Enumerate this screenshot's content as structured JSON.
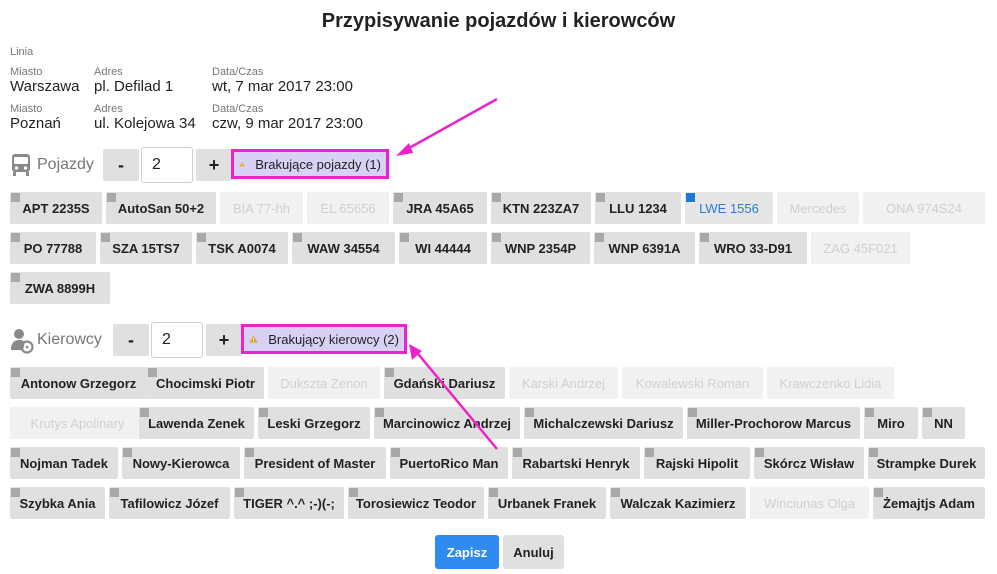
{
  "title": "Przypisywanie pojazdów i kierowców",
  "line_label": "Linia",
  "stops": [
    {
      "city_label": "Miasto",
      "city": "Warszawa",
      "address_label": "Adres",
      "address": "pl. Defilad 1",
      "datetime_label": "Data/Czas",
      "datetime": "wt, 7 mar 2017 23:00"
    },
    {
      "city_label": "Miasto",
      "city": "Poznań",
      "address_label": "Adres",
      "address": "ul. Kolejowa 34",
      "datetime_label": "Data/Czas",
      "datetime": "czw, 9 mar 2017 23:00"
    }
  ],
  "vehicles": {
    "label": "Pojazdy",
    "icon": "bus-icon",
    "minus": "-",
    "plus": "+",
    "count": "2",
    "warning": "Brakujące pojazdy (1)",
    "items": [
      {
        "label": "APT 2235S",
        "state": "normal"
      },
      {
        "label": "AutoSan 50+2",
        "state": "normal"
      },
      {
        "label": "BIA 77-hh",
        "state": "disabled"
      },
      {
        "label": "EL 65656",
        "state": "disabled"
      },
      {
        "label": "JRA 45A65",
        "state": "normal"
      },
      {
        "label": "KTN 223ZA7",
        "state": "normal"
      },
      {
        "label": "LLU 1234",
        "state": "normal"
      },
      {
        "label": "LWE 1556",
        "state": "selected"
      },
      {
        "label": "Mercedes",
        "state": "disabled"
      },
      {
        "label": "ONA 974S24",
        "state": "disabled"
      },
      {
        "label": "PO 77788",
        "state": "normal"
      },
      {
        "label": "SZA 15TS7",
        "state": "normal"
      },
      {
        "label": "TSK A0074",
        "state": "normal"
      },
      {
        "label": "WAW 34554",
        "state": "normal"
      },
      {
        "label": "WI 44444",
        "state": "normal"
      },
      {
        "label": "WNP 2354P",
        "state": "normal"
      },
      {
        "label": "WNP 6391A",
        "state": "normal"
      },
      {
        "label": "WRO 33-D91",
        "state": "normal"
      },
      {
        "label": "ZAG 45F021",
        "state": "disabled"
      },
      {
        "label": "ZWA 8899H",
        "state": "normal"
      }
    ]
  },
  "drivers": {
    "label": "Kierowcy",
    "icon": "driver-icon",
    "minus": "-",
    "plus": "+",
    "count": "2",
    "warning": "Brakujący kierowcy (2)",
    "items": [
      {
        "label": "Antonow Grzegorz",
        "state": "normal"
      },
      {
        "label": "Chocimski Piotr",
        "state": "normal"
      },
      {
        "label": "Dukszta Zenon",
        "state": "disabled"
      },
      {
        "label": "Gdański Dariusz",
        "state": "normal"
      },
      {
        "label": "Karski Andrzej",
        "state": "disabled"
      },
      {
        "label": "Kowalewski Roman",
        "state": "disabled"
      },
      {
        "label": "Krawczenko Lidia",
        "state": "disabled"
      },
      {
        "label": "Krutys Apolinary",
        "state": "disabled"
      },
      {
        "label": "Lawenda Zenek",
        "state": "normal"
      },
      {
        "label": "Leski Grzegorz",
        "state": "normal"
      },
      {
        "label": "Marcinowicz Andrzej",
        "state": "normal"
      },
      {
        "label": "Michalczewski Dariusz",
        "state": "normal"
      },
      {
        "label": "Miller-Prochorow Marcus",
        "state": "normal"
      },
      {
        "label": "Miro",
        "state": "normal"
      },
      {
        "label": "NN",
        "state": "normal"
      },
      {
        "label": "Nojman Tadek",
        "state": "normal"
      },
      {
        "label": "Nowy-Kierowca",
        "state": "normal"
      },
      {
        "label": "President of Master",
        "state": "normal"
      },
      {
        "label": "PuertoRico Man",
        "state": "normal"
      },
      {
        "label": "Rabartski Henryk",
        "state": "normal"
      },
      {
        "label": "Rajski Hipolit",
        "state": "normal"
      },
      {
        "label": "Skórcz Wisław",
        "state": "normal"
      },
      {
        "label": "Strampke Durek",
        "state": "normal"
      },
      {
        "label": "Szybka Ania",
        "state": "normal"
      },
      {
        "label": "Tafilowicz Józef",
        "state": "normal"
      },
      {
        "label": "TIGER ^.^ ;-)(-;",
        "state": "normal"
      },
      {
        "label": "Torosiewicz Teodor",
        "state": "normal"
      },
      {
        "label": "Urbanek Franek",
        "state": "normal"
      },
      {
        "label": "Walczak Kazimierz",
        "state": "normal"
      },
      {
        "label": "Winciunas Olga",
        "state": "disabled"
      },
      {
        "label": "Żemajtjs Adam",
        "state": "normal"
      }
    ]
  },
  "actions": {
    "save": "Zapisz",
    "cancel": "Anuluj"
  },
  "colors": {
    "highlight": "#ee22cc",
    "warning_bg": "#d8d0f5",
    "primary": "#2f8bf0",
    "selected_text": "#2a7bd6"
  }
}
